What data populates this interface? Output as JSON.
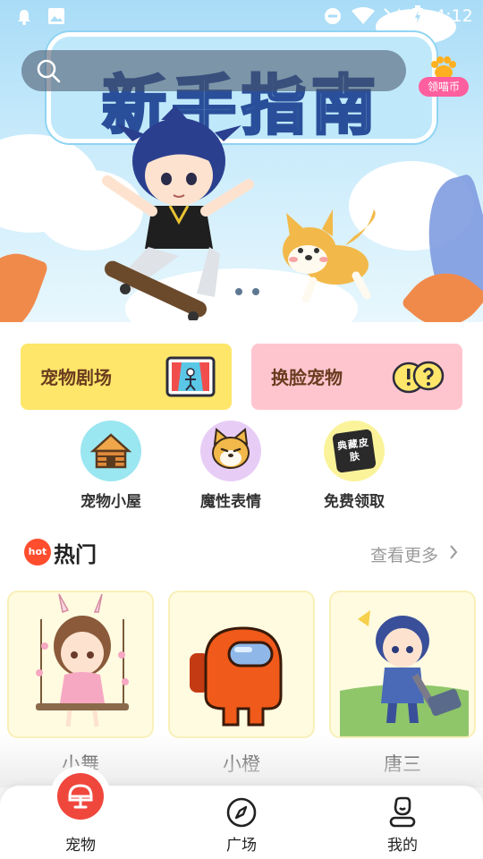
{
  "status_bar": {
    "time": "4:12"
  },
  "banner": {
    "title": "新手指南",
    "coin_button_label": "领喵币",
    "carousel_total": 3,
    "carousel_active_index": 0
  },
  "feature_cards": [
    {
      "label": "宠物剧场",
      "icon": "theater-icon"
    },
    {
      "label": "换脸宠物",
      "icon": "face-swap-icon"
    }
  ],
  "shortcuts": [
    {
      "label": "宠物小屋",
      "icon": "house-icon"
    },
    {
      "label": "魔性表情",
      "icon": "dog-face-icon"
    },
    {
      "label": "免费领取",
      "icon": "skin-badge-icon",
      "badge_text": "典藏皮肤"
    }
  ],
  "hot_section": {
    "badge": "hot",
    "title": "热门",
    "more_label": "查看更多"
  },
  "pets": [
    {
      "name": "小舞"
    },
    {
      "name": "小橙"
    },
    {
      "name": "唐三"
    }
  ],
  "bottom_nav": {
    "active": "宠物",
    "items": [
      {
        "label": "宠物",
        "icon": "pet-icon"
      },
      {
        "label": "广场",
        "icon": "compass-icon"
      },
      {
        "label": "我的",
        "icon": "profile-icon"
      }
    ]
  },
  "colors": {
    "accent_red": "#f0473d",
    "card_yellow": "#fde66a",
    "card_pink": "#ffc5cf",
    "coin_pink": "#ff5f9e"
  }
}
